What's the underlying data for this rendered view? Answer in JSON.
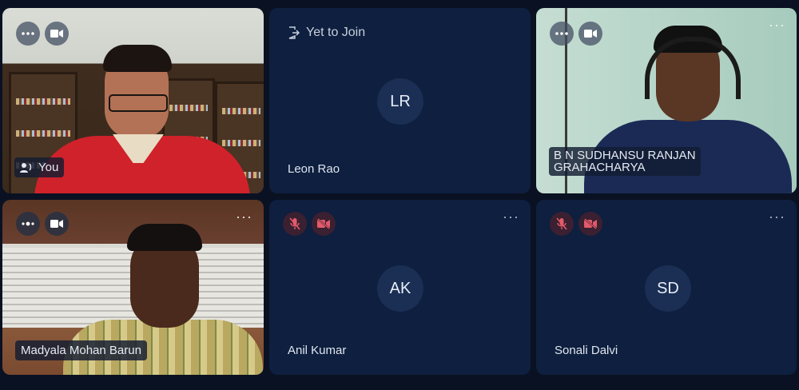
{
  "tiles": {
    "you": {
      "name": "You",
      "icons": [
        "more-icon",
        "video-icon",
        "speaker-icon"
      ]
    },
    "leon": {
      "status": "Yet to Join",
      "initials": "LR",
      "name": "Leon Rao"
    },
    "bn": {
      "name_line1": "B N SUDHANSU RANJAN",
      "name_line2": "GRAHACHARYA"
    },
    "madyala": {
      "name": "Madyala Mohan Barun"
    },
    "anil": {
      "initials": "AK",
      "name": "Anil Kumar"
    },
    "sonali": {
      "initials": "SD",
      "name": "Sonali Dalvi"
    }
  },
  "colors": {
    "background": "#0a1122",
    "tile": "#0e1f3f",
    "avatar": "#1b2f55",
    "muted_icon": "#e35a6a"
  }
}
